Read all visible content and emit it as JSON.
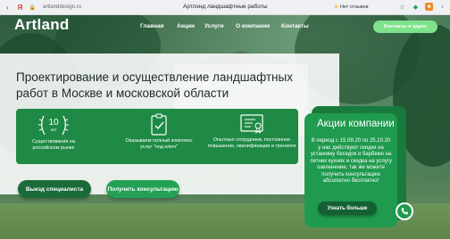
{
  "browser": {
    "url": "artlanddesign.ru",
    "tab_title": "Артлэнд ландшафтные работы",
    "reviews_label": "Нет отзывов",
    "back_icon": "chevron-left-icon",
    "yandex_icon": "yandex-icon"
  },
  "site": {
    "logo": "Artland",
    "nav": [
      "Главная",
      "Акции",
      "Услуги",
      "О компании",
      "Контакты"
    ],
    "contact_button": "Контакты и адрес"
  },
  "hero": {
    "heading": "Проектирование и осуществление ландшафтных работ в Москве и московской области",
    "features": [
      {
        "icon": "laurel-badge-icon",
        "big": "10",
        "small": "лет",
        "text": "Существования на российском рынке"
      },
      {
        "icon": "checklist-icon",
        "text": "Оказываем полный комплекс услуг \"под ключ\""
      },
      {
        "icon": "certificate-icon",
        "text": "Опытные сотрудники, постоянное повышение, квалификации и тренинги"
      }
    ],
    "button_visit": "Выезд специалиста",
    "button_consult": "Получить консультацию"
  },
  "promo": {
    "title": "Акции компании",
    "text": "В период с 15.09.20 по 25.10.20 у нас действуют скидки на установку беседок и барбекю на летних кухнях и скидка на услугу озеленение, так же можете получить консультацию абсолютно бесплатно!",
    "button": "Узнать больше",
    "phone_icon": "phone-icon"
  },
  "colors": {
    "brand_green": "#1f9a4e",
    "light_green": "#7ee28a",
    "dark_green": "#1a6a3a"
  }
}
